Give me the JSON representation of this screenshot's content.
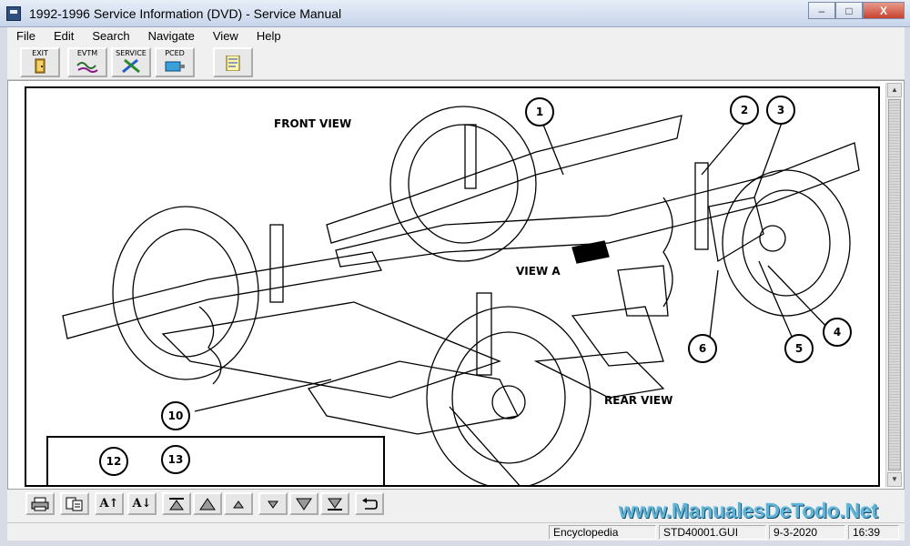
{
  "window": {
    "title": "1992-1996 Service Information (DVD) - Service Manual",
    "controls": {
      "minimize": "–",
      "maximize": "□",
      "close": "X"
    }
  },
  "menu": [
    "File",
    "Edit",
    "Search",
    "Navigate",
    "View",
    "Help"
  ],
  "toolbar": {
    "buttons": [
      {
        "label": "EXIT",
        "icon": "door-exit-icon"
      },
      {
        "label": "EVTM",
        "icon": "wiring-diagram-icon"
      },
      {
        "label": "SERVICE",
        "icon": "tools-icon"
      },
      {
        "label": "PCED",
        "icon": "engine-diagnosis-icon"
      },
      {
        "label": "",
        "icon": "document-list-icon"
      }
    ]
  },
  "diagram": {
    "labels": {
      "front_view": "FRONT VIEW",
      "view_a": "VIEW A",
      "rear_view": "REAR VIEW"
    },
    "callouts": [
      "1",
      "2",
      "3",
      "4",
      "5",
      "6",
      "10",
      "12",
      "13"
    ]
  },
  "navigation": {
    "buttons": [
      {
        "label": "",
        "icon": "print-icon"
      },
      {
        "label": "",
        "icon": "copy-icon"
      },
      {
        "label": "A↑",
        "icon": "font-increase-icon"
      },
      {
        "label": "A↓",
        "icon": "font-decrease-icon"
      },
      {
        "label": "",
        "icon": "first-page-icon"
      },
      {
        "label": "",
        "icon": "previous-section-icon"
      },
      {
        "label": "",
        "icon": "previous-page-icon"
      },
      {
        "label": "",
        "icon": "next-page-icon"
      },
      {
        "label": "",
        "icon": "next-section-icon"
      },
      {
        "label": "",
        "icon": "last-page-icon"
      },
      {
        "label": "",
        "icon": "back-icon"
      }
    ]
  },
  "watermark": "www.ManualesDeTodo.Net",
  "status": {
    "section": "Encyclopedia",
    "file": "STD40001.GUI",
    "date": "9-3-2020",
    "time": "16:39"
  }
}
